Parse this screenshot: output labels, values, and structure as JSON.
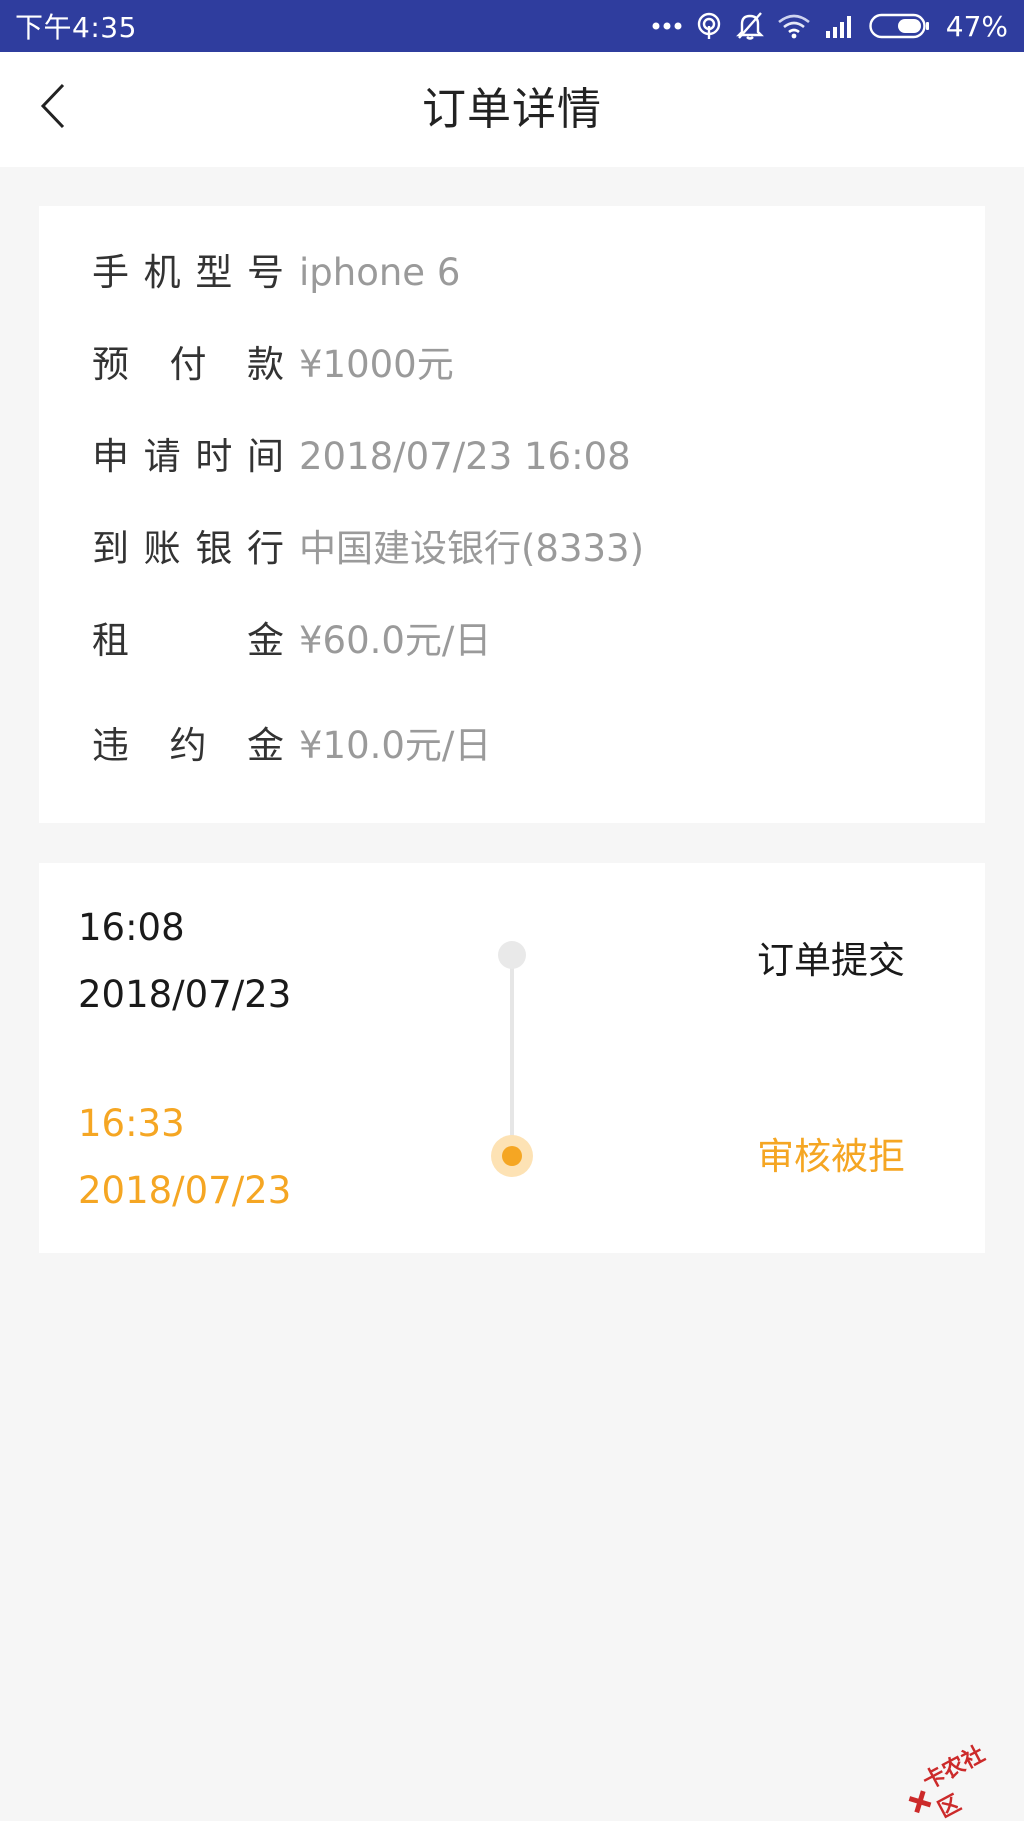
{
  "status_bar": {
    "time": "下午4:35",
    "battery_percent": "47%",
    "battery_level": 0.47,
    "icons": [
      "more-dots-icon",
      "hotspot-icon",
      "mute-bell-icon",
      "wifi-icon",
      "signal-icon",
      "battery-icon"
    ],
    "background": "#2f3d9e"
  },
  "nav": {
    "title": "订单详情",
    "back_icon": "chevron-left-icon"
  },
  "order_info": {
    "rows": [
      {
        "label": "手机型号",
        "value": "iphone 6"
      },
      {
        "label": "预付款",
        "value": "¥1000元"
      },
      {
        "label": "申请时间",
        "value": "2018/07/23 16:08"
      },
      {
        "label": "到账银行",
        "value": "中国建设银行(8333)"
      },
      {
        "label": "租金",
        "value": "¥60.0元/日"
      },
      {
        "label": "违约金",
        "value": "¥10.0元/日"
      }
    ]
  },
  "timeline": {
    "events": [
      {
        "time": "16:08",
        "date": "2018/07/23",
        "status": "订单提交",
        "active": false
      },
      {
        "time": "16:33",
        "date": "2018/07/23",
        "status": "审核被拒",
        "active": true
      }
    ],
    "accent_color": "#f5a623"
  },
  "watermark": {
    "text": "卡农社区"
  }
}
